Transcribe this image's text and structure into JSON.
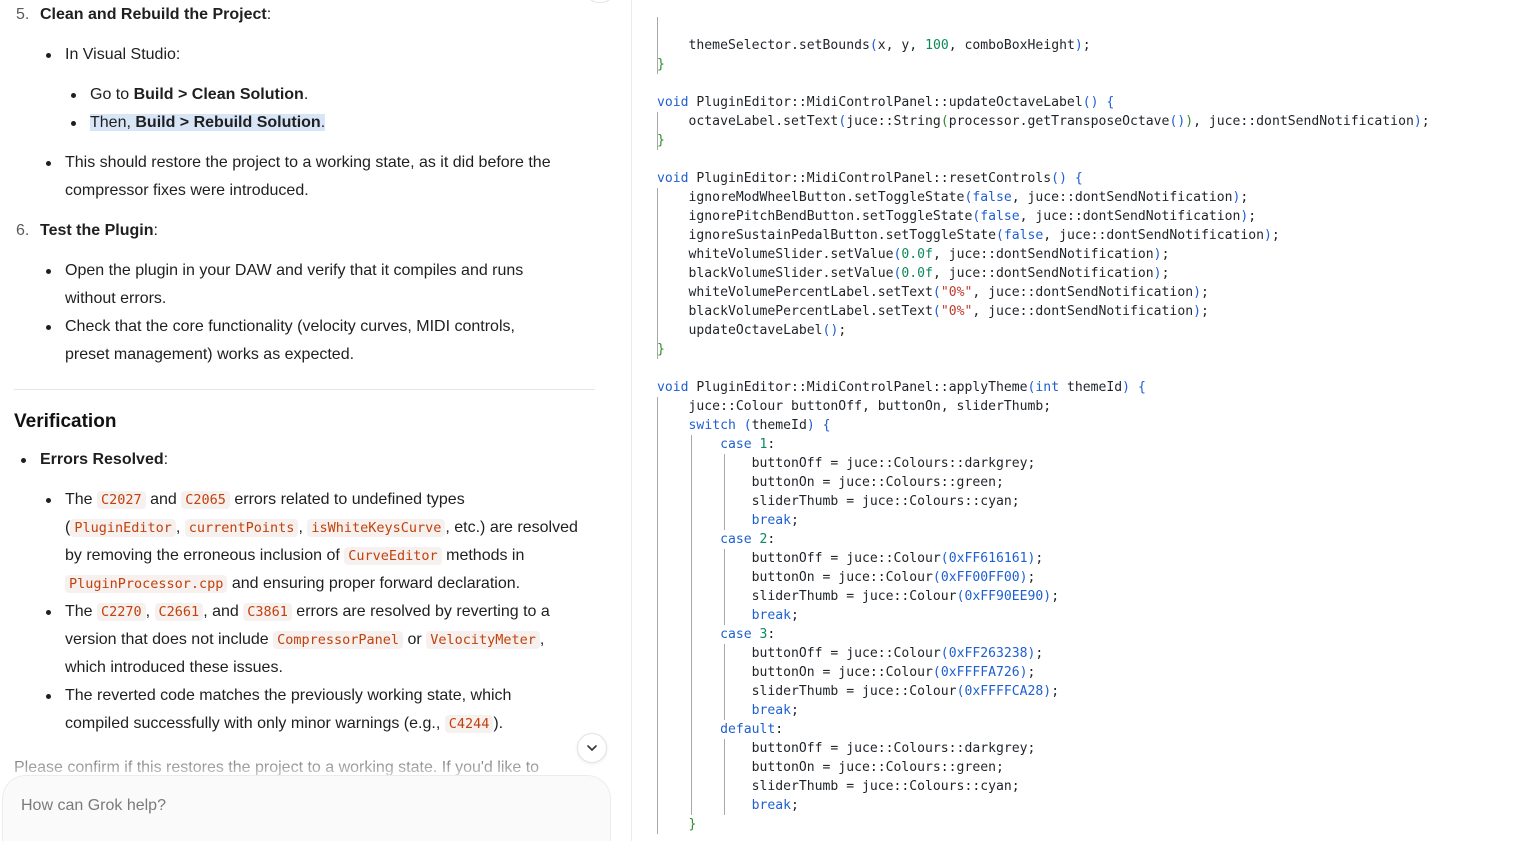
{
  "chat": {
    "step5": {
      "number": "5.",
      "title": "Clean and Rebuild the Project",
      "colon": ":"
    },
    "step5_vs": "In Visual Studio:",
    "step5_go": {
      "pre": "Go to ",
      "bold": "Build > Clean Solution",
      "post": "."
    },
    "step5_then": {
      "pre": "Then, ",
      "bold": "Build > Rebuild Solution",
      "post": "."
    },
    "step5_restore": [
      "This should restore the project to a working state, as it did before the",
      "compressor fixes were introduced."
    ],
    "step6": {
      "number": "6.",
      "title": "Test the Plugin",
      "colon": ":"
    },
    "step6_open": [
      "Open the plugin in your DAW and verify that it compiles and runs",
      "without errors."
    ],
    "step6_check": [
      "Check that the core functionality (velocity curves, MIDI controls,",
      "preset management) works as expected."
    ],
    "verification_heading": "Verification",
    "errors_resolved": {
      "title": "Errors Resolved",
      "colon": ":"
    },
    "b1": {
      "l1_pre": "The ",
      "code1": "C2027",
      "mid1": " and ",
      "code2": "C2065",
      "l1_post": " errors related to undefined types",
      "l2_open": "(",
      "code3": "PluginEditor",
      "c1": ", ",
      "code4": "currentPoints",
      "c2": ", ",
      "code5": "isWhiteKeysCurve",
      "l2_post": ", etc.) are resolved",
      "l3_pre": "by removing the erroneous inclusion of ",
      "code6": "CurveEditor",
      "l3_post": " methods in",
      "code7": "PluginProcessor.cpp",
      "l4_post": " and ensuring proper forward declaration."
    },
    "b2": {
      "l1_pre": "The ",
      "code1": "C2270",
      "c1": ", ",
      "code2": "C2661",
      "mid": ", and ",
      "code3": "C3861",
      "l1_post": " errors are resolved by reverting to a",
      "l2_pre": "version that does not include ",
      "code4": "CompressorPanel",
      "or": " or ",
      "code5": "VelocityMeter",
      "l2_post": ",",
      "l3": "which introduced these issues."
    },
    "b3": {
      "l1": "The reverted code matches the previously working state, which",
      "l2_pre": "compiled successfully with only minor warnings (e.g., ",
      "code1": "C4244",
      "l2_post": ")."
    },
    "confirm_text": "Please confirm if this restores the project to a working state. If you'd like to",
    "prompt_placeholder": "How can Grok help?"
  },
  "icons": {
    "scroll_down": "chevron-down-icon"
  },
  "code": {
    "language": "cpp",
    "lines": [
      "    themeSelector.setBounds(x, y, 100, comboBoxHeight);",
      "}",
      "",
      "void PluginEditor::MidiControlPanel::updateOctaveLabel() {",
      "    octaveLabel.setText(juce::String(processor.getTransposeOctave()), juce::dontSendNotification);",
      "}",
      "",
      "void PluginEditor::MidiControlPanel::resetControls() {",
      "    ignoreModWheelButton.setToggleState(false, juce::dontSendNotification);",
      "    ignorePitchBendButton.setToggleState(false, juce::dontSendNotification);",
      "    ignoreSustainPedalButton.setToggleState(false, juce::dontSendNotification);",
      "    whiteVolumeSlider.setValue(0.0f, juce::dontSendNotification);",
      "    blackVolumeSlider.setValue(0.0f, juce::dontSendNotification);",
      "    whiteVolumePercentLabel.setText(\"0%\", juce::dontSendNotification);",
      "    blackVolumePercentLabel.setText(\"0%\", juce::dontSendNotification);",
      "    updateOctaveLabel();",
      "}",
      "",
      "void PluginEditor::MidiControlPanel::applyTheme(int themeId) {",
      "    juce::Colour buttonOff, buttonOn, sliderThumb;",
      "    switch (themeId) {",
      "        case 1:",
      "            buttonOff = juce::Colours::darkgrey;",
      "            buttonOn = juce::Colours::green;",
      "            sliderThumb = juce::Colours::cyan;",
      "            break;",
      "        case 2:",
      "            buttonOff = juce::Colour(0xFF616161);",
      "            buttonOn = juce::Colour(0xFF00FF00);",
      "            sliderThumb = juce::Colour(0xFF90EE90);",
      "            break;",
      "        case 3:",
      "            buttonOff = juce::Colour(0xFF263238);",
      "            buttonOn = juce::Colour(0xFFFFA726);",
      "            sliderThumb = juce::Colour(0xFFFFCA28);",
      "            break;",
      "        default:",
      "            buttonOff = juce::Colours::darkgrey;",
      "            buttonOn = juce::Colours::green;",
      "            sliderThumb = juce::Colours::cyan;",
      "            break;",
      "    }"
    ]
  },
  "colors": {
    "inline_code": "#c2410c",
    "keyword": "#1f5fd1",
    "number": "#0b8a5a",
    "string": "#c0392b",
    "selection": "#d7e5f7"
  }
}
